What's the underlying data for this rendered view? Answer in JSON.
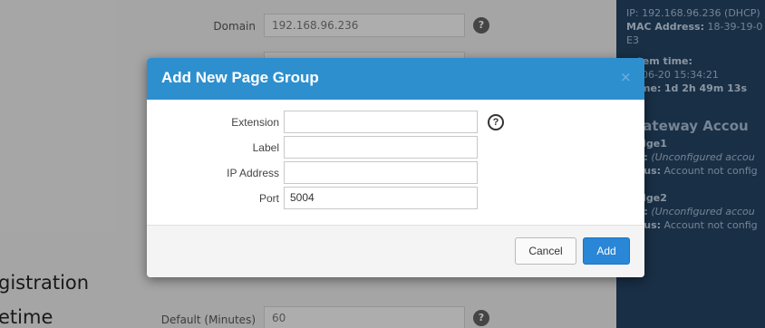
{
  "background": {
    "domain_label": "Domain",
    "domain_value": "192.168.96.236",
    "registration_heading_1": "gistration",
    "registration_heading_2": "etime",
    "default_minutes_label": "Default (Minutes)",
    "default_minutes_value": "60",
    "help_glyph": "?"
  },
  "sidebar": {
    "ip_line": "IP: 192.168.96.236 (DHCP)",
    "mac_label": "MAC Address:",
    "mac_value": "18-39-19-0",
    "mac_cont": "E3",
    "system_time_label": "stem time:",
    "system_time_value": "8-06-20 15:34:21",
    "uptime_label": "time:",
    "uptime_value": "1d 2h 49m 13s",
    "gateway_title": "Gateway Accou",
    "bridge1_name": "dge1",
    "bridge1_user_label": "r:",
    "bridge1_user_value": "(Unconfigured accou",
    "bridge1_status_label": "tus:",
    "bridge1_status_value": "Account not config",
    "bridge2_name": "dge2",
    "bridge2_user_label": "r:",
    "bridge2_user_value": "(Unconfigured accou",
    "bridge2_status_label": "tus:",
    "bridge2_status_value": "Account not config"
  },
  "modal": {
    "title": "Add New Page Group",
    "close_glyph": "×",
    "help_glyph": "?",
    "fields": [
      {
        "label": "Extension",
        "value": ""
      },
      {
        "label": "Label",
        "value": ""
      },
      {
        "label": "IP Address",
        "value": ""
      },
      {
        "label": "Port",
        "value": "5004"
      }
    ],
    "cancel_label": "Cancel",
    "add_label": "Add"
  },
  "colors": {
    "header_blue": "#2e8fcf",
    "primary_button": "#2a86d6",
    "sidebar_bg": "#1f3a55"
  },
  "icons": {
    "help": "question-circle-icon",
    "close": "close-icon"
  }
}
